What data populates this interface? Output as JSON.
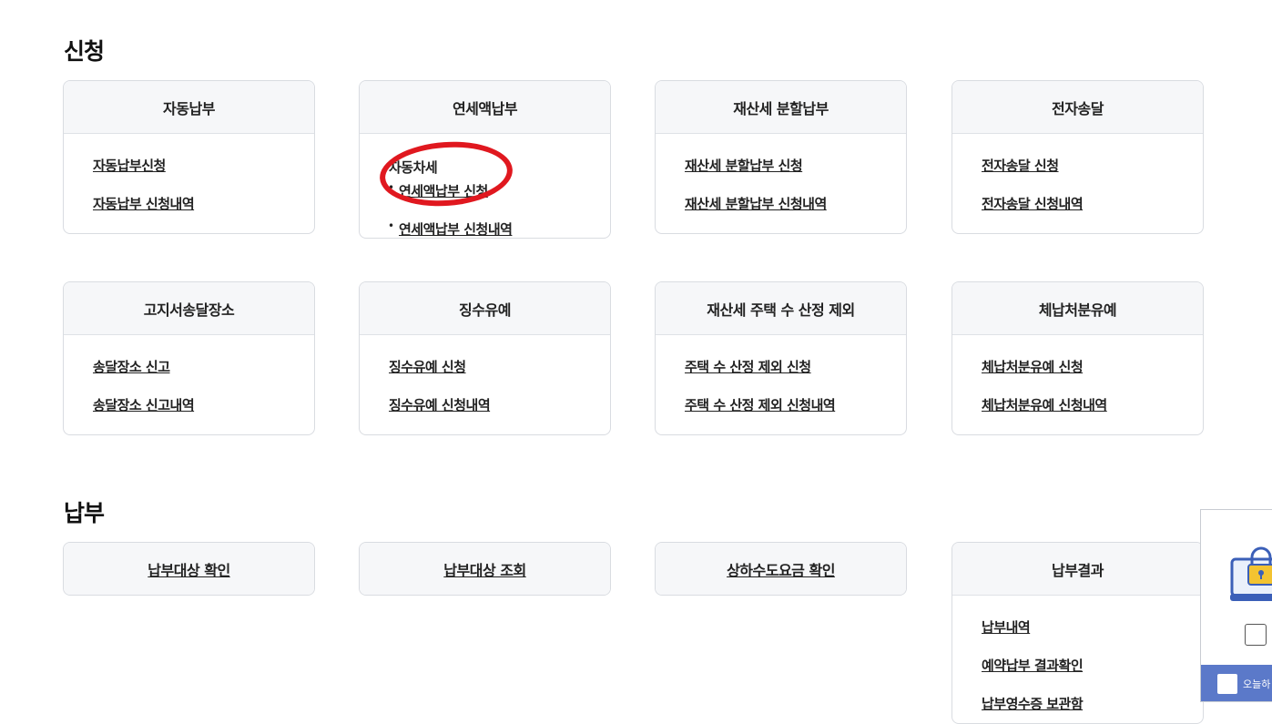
{
  "sections": {
    "apply_title": "신청",
    "pay_title": "납부"
  },
  "apply_cards": [
    {
      "title": "자동납부",
      "links": [
        "자동납부신청",
        "자동납부 신청내역"
      ]
    },
    {
      "title": "연세액납부",
      "subtitle": "자동차세",
      "bullets": [
        "연세액납부 신청",
        "연세액납부 신청내역"
      ]
    },
    {
      "title": "재산세 분할납부",
      "links": [
        "재산세 분할납부 신청",
        "재산세 분할납부 신청내역"
      ]
    },
    {
      "title": "전자송달",
      "links": [
        "전자송달 신청",
        "전자송달 신청내역"
      ]
    },
    {
      "title": "고지서송달장소",
      "links": [
        "송달장소 신고",
        "송달장소 신고내역"
      ]
    },
    {
      "title": "징수유예",
      "links": [
        "징수유예 신청",
        "징수유예 신청내역"
      ]
    },
    {
      "title": "재산세 주택 수 산정 제외",
      "links": [
        "주택 수 산정 제외 신청",
        "주택 수 산정 제외 신청내역"
      ]
    },
    {
      "title": "체납처분유예",
      "links": [
        "체납처분유예 신청",
        "체납처분유예 신청내역"
      ]
    }
  ],
  "pay_cards": [
    {
      "title": "납부대상 확인"
    },
    {
      "title": "납부대상 조회"
    },
    {
      "title": "상하수도요금 확인"
    },
    {
      "title": "납부결과",
      "links": [
        "납부내역",
        "예약납부 결과확인",
        "납부영수증 보관함"
      ]
    }
  ],
  "popup": {
    "icon": "lock-laptop-icon",
    "bottom_label": "오늘하"
  },
  "colors": {
    "annotation": "#e0181f",
    "popup_bar": "#5b79c9",
    "card_header_bg": "#f6f7f9"
  }
}
